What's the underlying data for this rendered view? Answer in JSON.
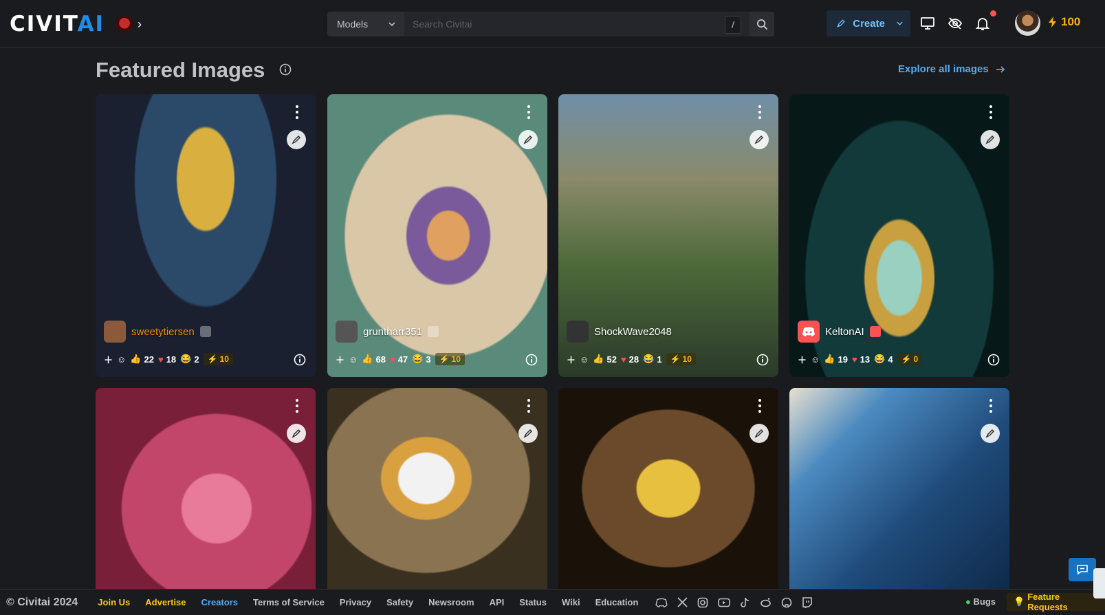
{
  "header": {
    "logo_text_a": "CIVIT",
    "logo_text_b": "AI",
    "search_category": "Models",
    "search_placeholder": "Search Civitai",
    "search_shortcut": "/",
    "create_label": "Create",
    "buzz_amount": "100"
  },
  "main": {
    "section_title": "Featured Images",
    "explore_label": "Explore all images",
    "cards": [
      {
        "user": "sweetytiersen",
        "likes": "22",
        "hearts": "18",
        "laughs": "2",
        "buzz": "10",
        "bg": "#2a3b55",
        "user_color": "#f08c00"
      },
      {
        "user": "gruntharr351",
        "likes": "68",
        "hearts": "47",
        "laughs": "3",
        "buzz": "10",
        "bg": "#8c6f5a",
        "user_color": "#ffffff"
      },
      {
        "user": "ShockWave2048",
        "likes": "52",
        "hearts": "28",
        "laughs": "1",
        "buzz": "10",
        "bg": "#4b5a3a",
        "user_color": "#ffffff"
      },
      {
        "user": "KeltonAI",
        "likes": "19",
        "hearts": "13",
        "laughs": "4",
        "buzz": "0",
        "bg": "#0f3a3a",
        "user_color": "#ffffff"
      },
      {
        "bg": "#c2466a"
      },
      {
        "bg": "#a08a6a"
      },
      {
        "bg": "#3a2a1a"
      },
      {
        "bg": "#1f4a7a"
      }
    ]
  },
  "footer": {
    "copyright": "© Civitai 2024",
    "join": "Join Us",
    "advertise": "Advertise",
    "creators": "Creators",
    "tos": "Terms of Service",
    "privacy": "Privacy",
    "safety": "Safety",
    "newsroom": "Newsroom",
    "api": "API",
    "status": "Status",
    "wiki": "Wiki",
    "education": "Education",
    "bugs": "Bugs",
    "feature_requests": "Feature Requests"
  },
  "colors": {
    "background": "#1a1b1e",
    "accent": "#228be6",
    "buzz": "#fab005",
    "link": "#4dabf7"
  },
  "icons": [
    "search-icon",
    "chevron-down-icon",
    "pencil-brush-icon",
    "monitor-icon",
    "eye-off-icon",
    "bell-icon",
    "lightning-icon",
    "info-icon",
    "arrow-right-icon",
    "dots-vertical-icon",
    "remix-brush-icon",
    "plus-icon",
    "smile-icon",
    "thumbs-up-icon",
    "heart-icon",
    "laugh-icon",
    "discord-icon",
    "x-icon",
    "instagram-icon",
    "youtube-icon",
    "tiktok-icon",
    "reddit-icon",
    "github-icon",
    "twitch-icon",
    "chat-icon"
  ]
}
